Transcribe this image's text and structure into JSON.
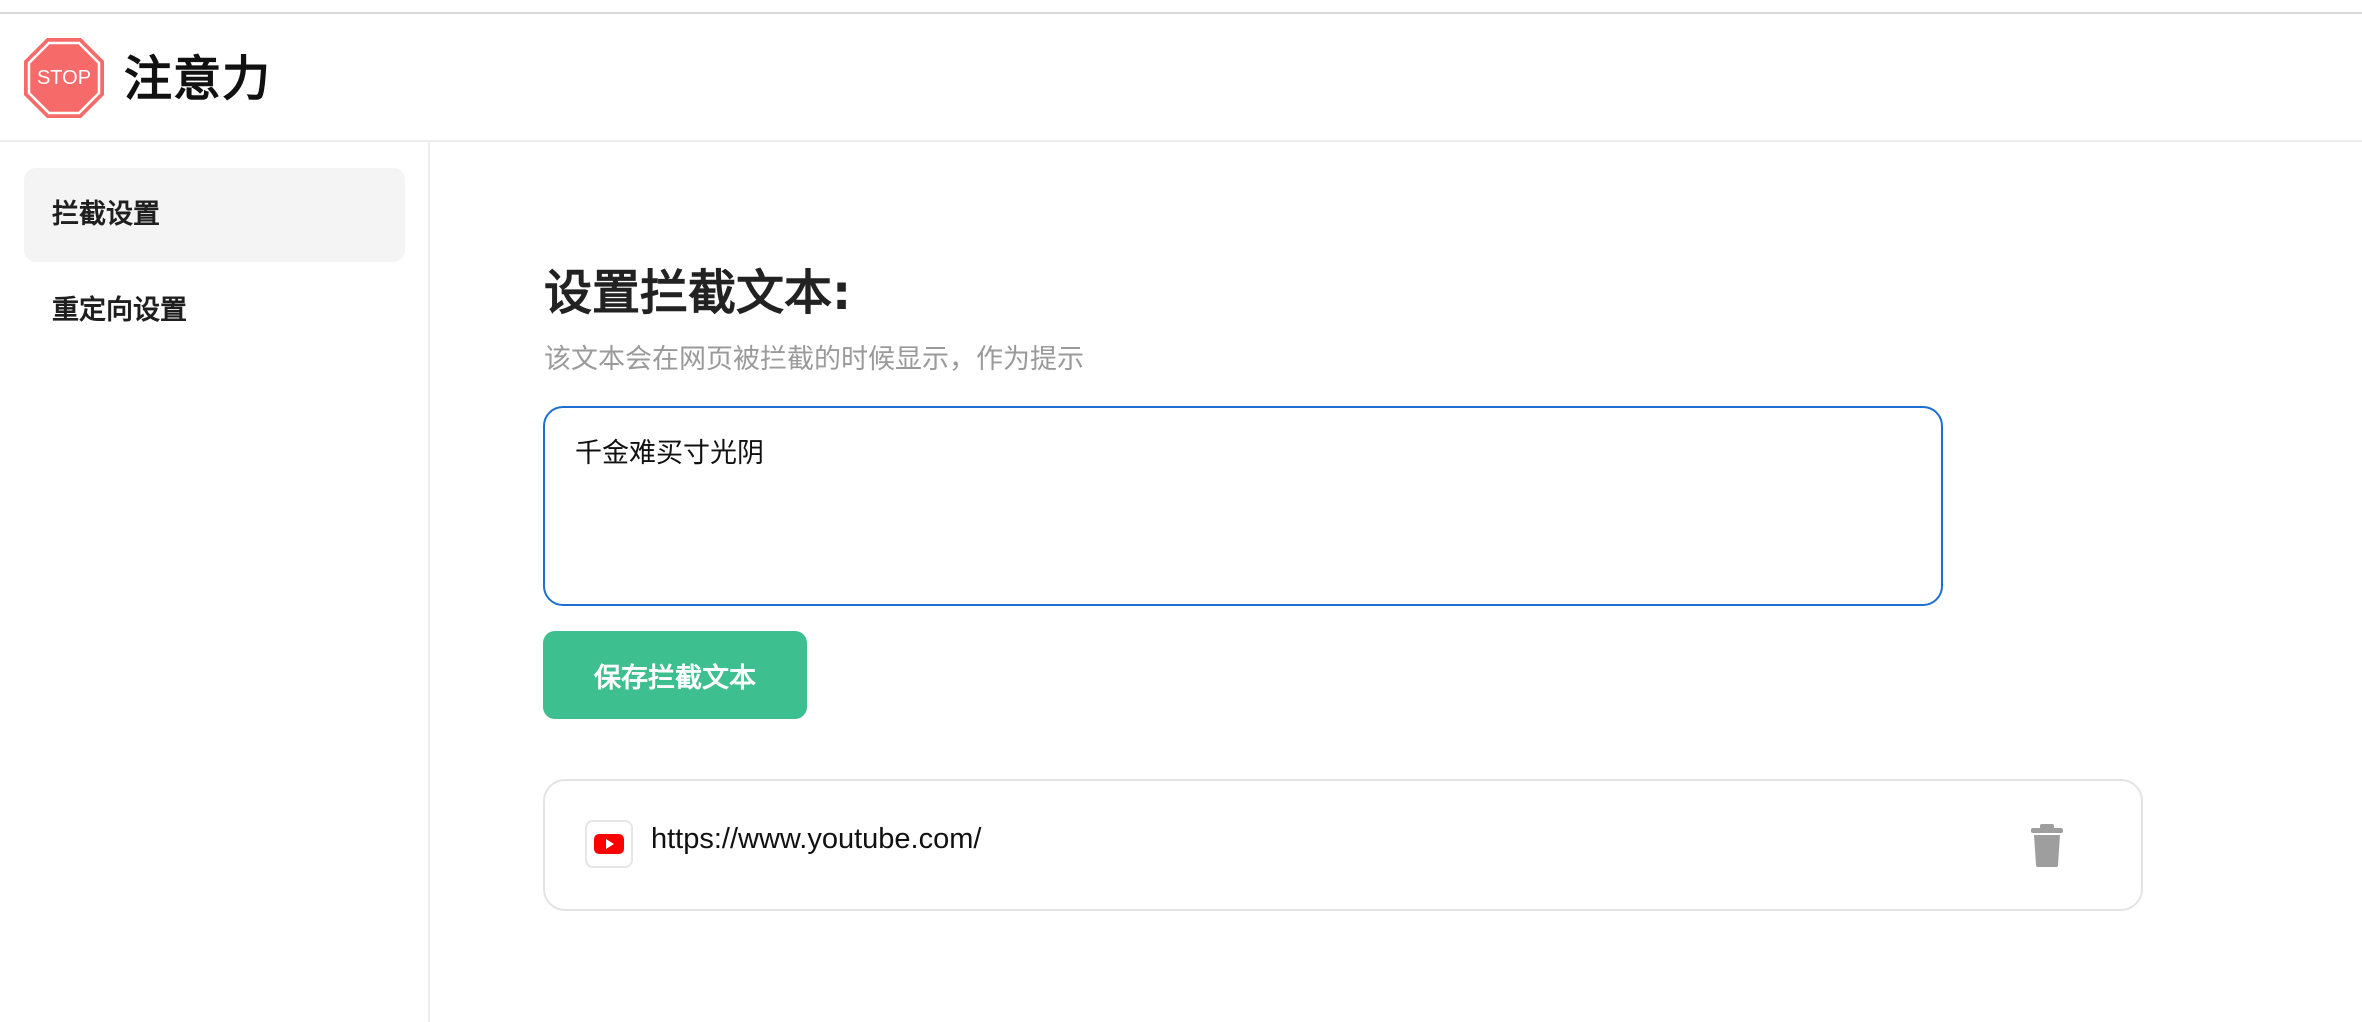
{
  "header": {
    "logo_text": "STOP",
    "title": "注意力"
  },
  "sidebar": {
    "items": [
      {
        "label": "拦截设置",
        "active": true
      },
      {
        "label": "重定向设置",
        "active": false
      }
    ]
  },
  "main": {
    "section_title": "设置拦截文本:",
    "section_desc": "该文本会在网页被拦截的时候显示，作为提示",
    "block_text_value": "千金难买寸光阴",
    "save_button_label": "保存拦截文本",
    "blocked_sites": [
      {
        "url": "https://www.youtube.com/",
        "icon": "youtube-icon"
      }
    ]
  },
  "colors": {
    "logo_red": "#f76a6a",
    "accent_green": "#3dbf8f",
    "focus_blue": "#1d6fd1",
    "youtube_red": "#ff0000",
    "trash_gray": "#9e9e9e"
  }
}
